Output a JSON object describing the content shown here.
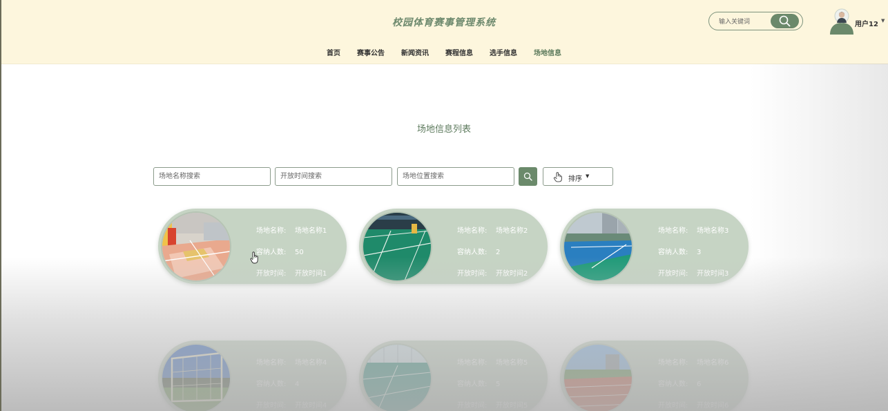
{
  "header": {
    "site_title": "校园体育赛事管理系统",
    "search_placeholder": "输入关键词",
    "user_name": "用户12",
    "nav": [
      "首页",
      "赛事公告",
      "新闻资讯",
      "赛程信息",
      "选手信息",
      "场地信息"
    ],
    "active_nav": "场地信息"
  },
  "main": {
    "title": "场地信息列表",
    "filters": {
      "name_placeholder": "场地名称搜索",
      "time_placeholder": "开放时间搜索",
      "location_placeholder": "场地位置搜索",
      "sort_label": "排序"
    },
    "labels": {
      "name": "场地名称:",
      "capacity": "容纳人数:",
      "open_time": "开放时间:"
    },
    "venues": [
      {
        "name": "场地名称1",
        "capacity": "50",
        "open_time": "开放时间1",
        "image": "indoor-court"
      },
      {
        "name": "场地名称2",
        "capacity": "2",
        "open_time": "开放时间2",
        "image": "badminton-court"
      },
      {
        "name": "场地名称3",
        "capacity": "3",
        "open_time": "开放时间3",
        "image": "tennis-court"
      },
      {
        "name": "场地名称4",
        "capacity": "4",
        "open_time": "开放时间4",
        "image": "soccer-goal"
      },
      {
        "name": "场地名称5",
        "capacity": "5",
        "open_time": "开放时间5",
        "image": "indoor-hall"
      },
      {
        "name": "场地名称6",
        "capacity": "6",
        "open_time": "开放时间6",
        "image": "running-track"
      }
    ]
  },
  "colors": {
    "header_bg": "#fdf6dd",
    "accent": "#6b896b",
    "card_bg": "#c6d4c4"
  }
}
